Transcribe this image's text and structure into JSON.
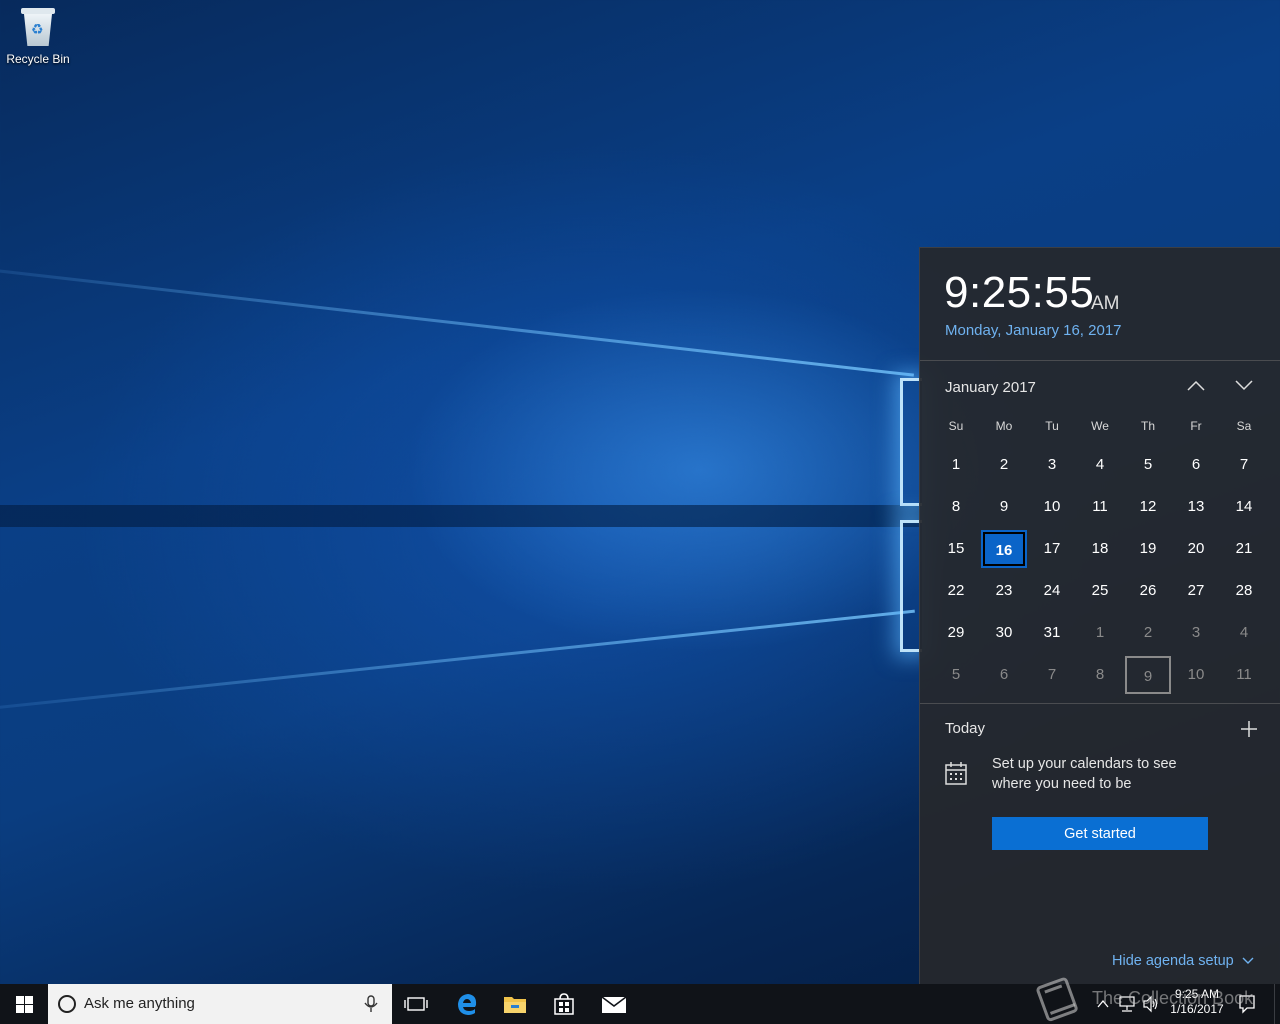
{
  "desktop": {
    "icons": [
      {
        "label": "Recycle Bin",
        "icon": "recycle-bin-icon"
      }
    ]
  },
  "flyout": {
    "time": "9:25:55",
    "ampm": "AM",
    "date_long": "Monday, January 16, 2017",
    "month_label": "January 2017",
    "weekdays": [
      "Su",
      "Mo",
      "Tu",
      "We",
      "Th",
      "Fr",
      "Sa"
    ],
    "weeks": [
      [
        "1",
        "2",
        "3",
        "4",
        "5",
        "6",
        "7"
      ],
      [
        "8",
        "9",
        "10",
        "11",
        "12",
        "13",
        "14"
      ],
      [
        "15",
        "16",
        "17",
        "18",
        "19",
        "20",
        "21"
      ],
      [
        "22",
        "23",
        "24",
        "25",
        "26",
        "27",
        "28"
      ],
      [
        "29",
        "30",
        "31",
        "1",
        "2",
        "3",
        "4"
      ],
      [
        "5",
        "6",
        "7",
        "8",
        "9",
        "10",
        "11"
      ]
    ],
    "today_label": "Today",
    "agenda_message": "Set up your calendars to see where you need to be",
    "get_started_label": "Get started",
    "hide_agenda_label": "Hide agenda setup",
    "accent_color": "#0a6fd3"
  },
  "taskbar": {
    "search_placeholder": "Ask me anything",
    "apps": [
      "task-view-icon",
      "edge-icon",
      "file-explorer-icon",
      "store-icon",
      "mail-icon"
    ],
    "clock_time": "9:25 AM",
    "clock_date": "1/16/2017"
  },
  "watermark": {
    "text": "The Collection Book"
  }
}
